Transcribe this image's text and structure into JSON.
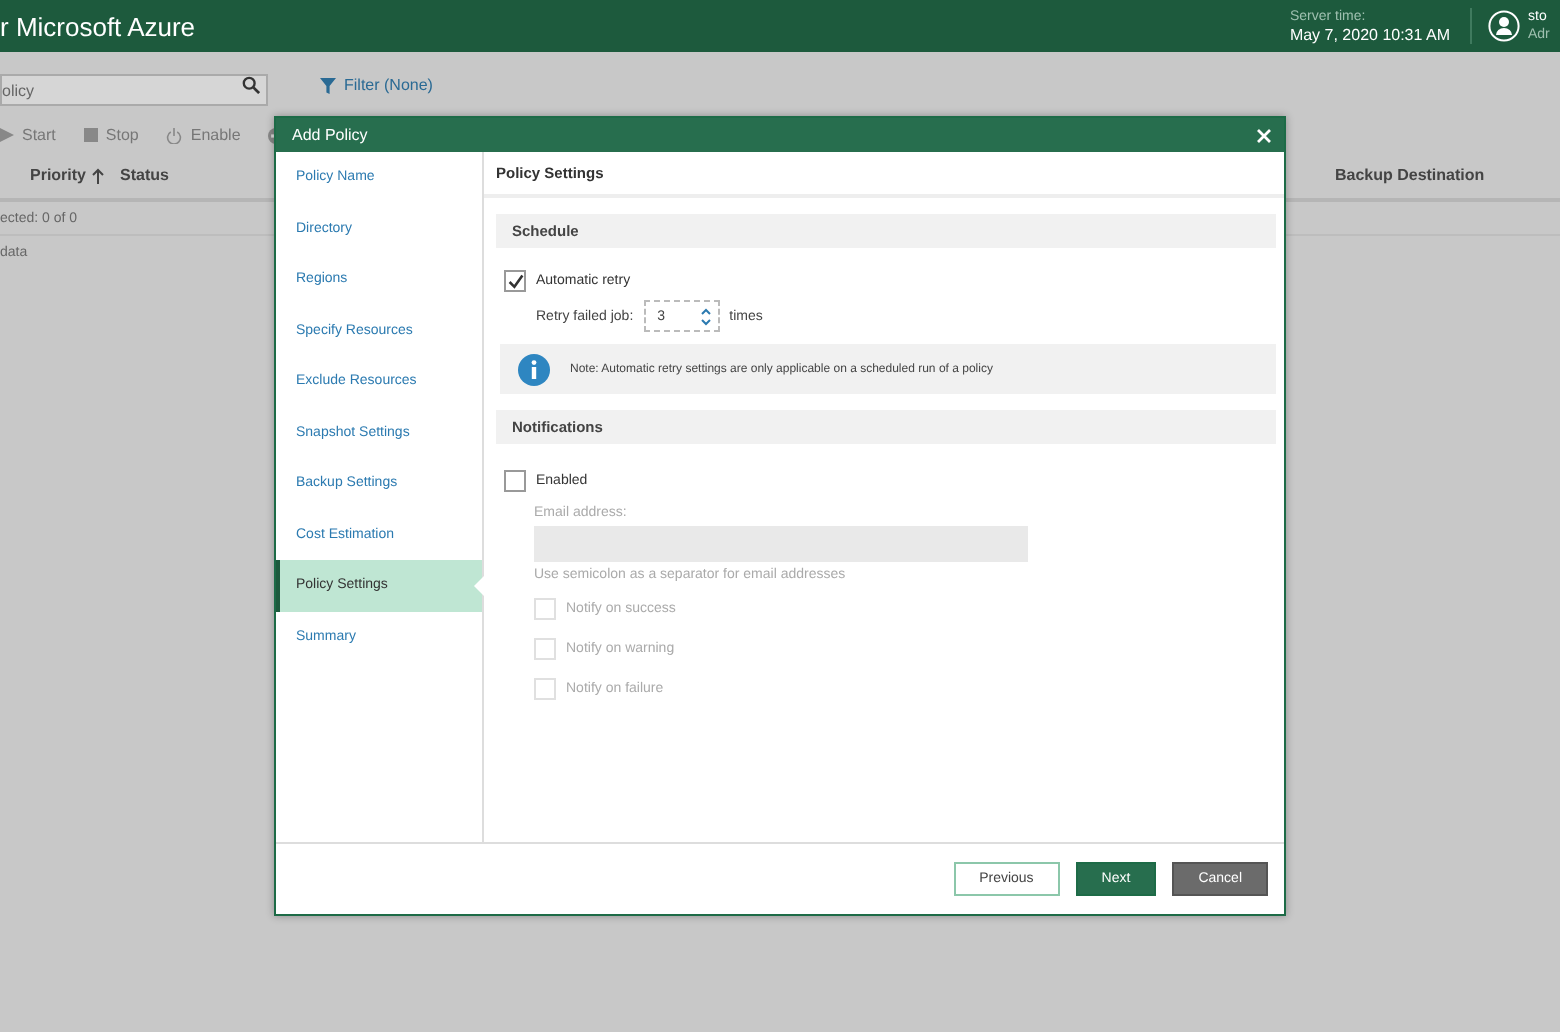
{
  "app_header": {
    "title": "r Microsoft Azure",
    "server_time_label": "Server time:",
    "server_time": "May 7, 2020 10:31 AM",
    "user_name": "sto",
    "user_role": "Adr"
  },
  "search": {
    "placeholder": "olicy"
  },
  "filter": {
    "label": "Filter (None)"
  },
  "toolbar": [
    {
      "label": "Start",
      "kind": "start"
    },
    {
      "label": "Stop",
      "kind": "stop"
    },
    {
      "label": "Enable",
      "kind": "enable"
    },
    {
      "kind": "disable"
    }
  ],
  "table": {
    "columns": [
      {
        "label": "Priority",
        "sorted": true
      },
      {
        "label": "Status",
        "sorted": false
      },
      {
        "label": "Backup Destination",
        "sorted": false
      }
    ],
    "selected_count": "ected:  0 of 0",
    "empty_text": "data"
  },
  "dialog": {
    "title": "Add Policy",
    "steps": [
      {
        "label": "Policy Name",
        "selected": false
      },
      {
        "label": "Directory",
        "selected": false
      },
      {
        "label": "Regions",
        "selected": false
      },
      {
        "label": "Specify Resources",
        "selected": false
      },
      {
        "label": "Exclude Resources",
        "selected": false
      },
      {
        "label": "Snapshot Settings",
        "selected": false
      },
      {
        "label": "Backup Settings",
        "selected": false
      },
      {
        "label": "Cost Estimation",
        "selected": false
      },
      {
        "label": "Policy Settings",
        "selected": true
      },
      {
        "label": "Summary",
        "selected": false
      }
    ],
    "page_title": "Policy Settings",
    "schedule": {
      "title": "Schedule",
      "automatic_retry": {
        "label": "Automatic retry",
        "checked": true
      },
      "retry_label": "Retry failed job:",
      "retry_value": "3",
      "retry_unit": "times",
      "note": "Note: Automatic retry settings are only applicable on a scheduled run of a policy"
    },
    "notifications": {
      "title": "Notifications",
      "enabled": {
        "label": "Enabled",
        "checked": false
      },
      "email_label": "Email address:",
      "email_hint": "Use semicolon as a separator for email addresses",
      "options": [
        {
          "label": "Notify on success",
          "checked": false,
          "disabled": true
        },
        {
          "label": "Notify on warning",
          "checked": false,
          "disabled": true
        },
        {
          "label": "Notify on failure",
          "checked": false,
          "disabled": true
        }
      ]
    },
    "buttons": [
      {
        "label": "Previous",
        "kind": "secondary"
      },
      {
        "label": "Next",
        "kind": "primary"
      },
      {
        "label": "Cancel",
        "kind": "cancel"
      }
    ]
  }
}
